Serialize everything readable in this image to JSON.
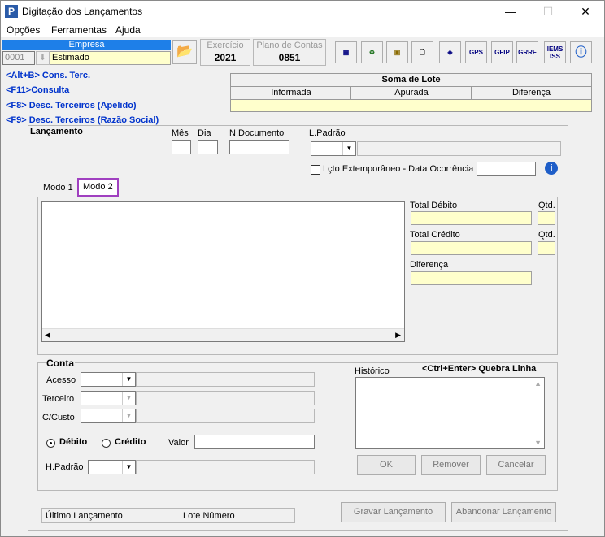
{
  "window": {
    "title": "Digitação dos Lançamentos",
    "minimize": "—",
    "maximize": "☐",
    "close": "✕"
  },
  "menu": [
    "Opções",
    "Ferramentas",
    "Ajuda"
  ],
  "empresa": {
    "header": "Empresa",
    "code": "0001",
    "name": "Estimado"
  },
  "exercicio": {
    "label": "Exercício",
    "value": "2021"
  },
  "plano": {
    "label": "Plano de Contas",
    "value": "0851"
  },
  "toolbar": [
    "GPS",
    "GFIP",
    "GRRF",
    "IEMS ISS"
  ],
  "shortcuts": [
    "<Alt+B> Cons. Terc.",
    "<F11>Consulta",
    "<F8> Desc. Terceiros (Apelido)",
    "<F9> Desc. Terceiros (Razão Social)"
  ],
  "soma": {
    "title": "Soma de Lote",
    "cols": [
      "Informada",
      "Apurada",
      "Diferença"
    ]
  },
  "lancamento": {
    "title": "Lançamento",
    "mes": "Mês",
    "dia": "Dia",
    "ndoc": "N.Documento",
    "lpadrao": "L.Padrão",
    "extemporaneo": "Lçto Extemporâneo - Data Ocorrência"
  },
  "tabs": [
    "Modo 1",
    "Modo 2"
  ],
  "totals": {
    "debito": "Total Débito",
    "credito": "Total Crédito",
    "qtd": "Qtd.",
    "diferenca": "Diferença"
  },
  "conta": {
    "title": "Conta",
    "acesso": "Acesso",
    "terceiro": "Terceiro",
    "ccusto": "C/Custo",
    "debito": "Débito",
    "credito": "Crédito",
    "valor": "Valor",
    "hpadrao": "H.Padrão"
  },
  "historico": {
    "label": "Histórico",
    "hint": "<Ctrl+Enter> Quebra Linha"
  },
  "buttons": {
    "ok": "OK",
    "remover": "Remover",
    "cancelar": "Cancelar",
    "gravar": "Gravar Lançamento",
    "abandonar": "Abandonar Lançamento"
  },
  "status": {
    "ultimo": "Último Lançamento",
    "lote": "Lote Número"
  }
}
